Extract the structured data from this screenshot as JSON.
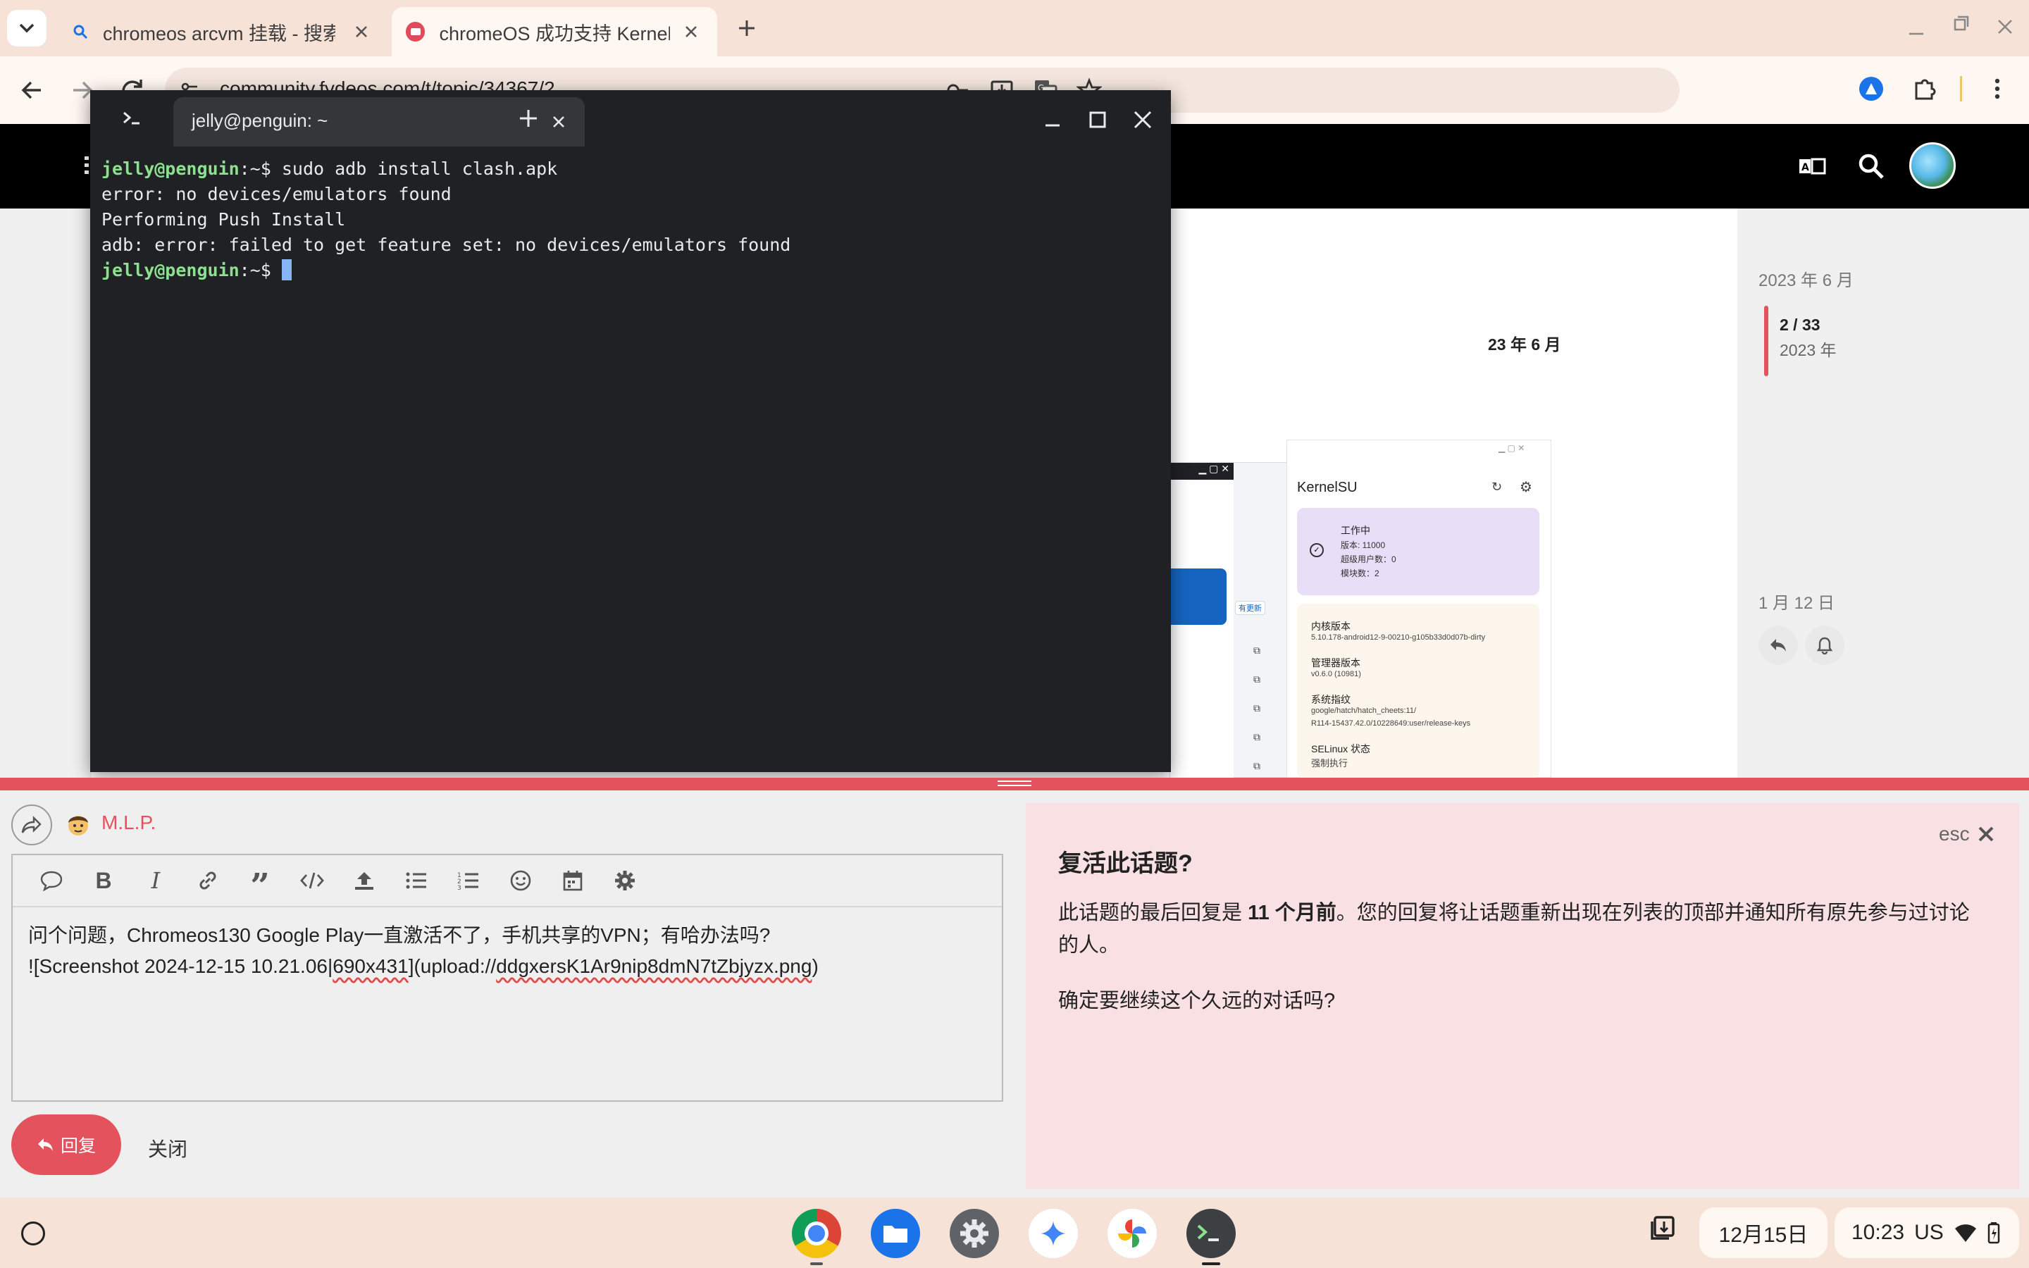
{
  "browser": {
    "tabs": [
      {
        "title": "chromeos arcvm 挂载 - 搜索",
        "active": false
      },
      {
        "title": "chromeOS 成功支持 KernelSU",
        "active": true
      }
    ],
    "url": "community.fydeos.com/t/topic/34367/2"
  },
  "terminal": {
    "tab_title": "jelly@penguin: ~",
    "lines": [
      {
        "user": "jelly@penguin",
        "path": ":~$",
        "cmd": " sudo adb install clash.apk"
      },
      {
        "text": "error: no devices/emulators found"
      },
      {
        "text": "Performing Push Install"
      },
      {
        "text": "adb: error: failed to get feature set: no devices/emulators found"
      },
      {
        "user": "jelly@penguin",
        "path": ":~$",
        "cmd": " "
      }
    ]
  },
  "post": {
    "date_label": "23 年 6 月",
    "kernelsu": {
      "app_name": "KernelSU",
      "status": "工作中",
      "version": "版本: 11000",
      "superusers": "超级用户数：0",
      "modules": "模块数：2",
      "kernel_label": "内核版本",
      "kernel_value": "5.10.178-android12-9-00210-g105b33d0d07b-dirty",
      "manager_label": "管理器版本",
      "manager_value": "v0.6.0 (10981)",
      "fingerprint_label": "系统指纹",
      "fingerprint_value_1": "google/hatch/hatch_cheets:11/",
      "fingerprint_value_2": "R114-15437.42.0/10228649:user/release-keys",
      "selinux_label": "SELinux 状态",
      "selinux_value": "强制执行",
      "update_badge": "有更新"
    }
  },
  "timeline": {
    "start": "2023 年 6 月",
    "position": "2 / 33",
    "position_date": "2023 年",
    "end": "1 月 12 日"
  },
  "composer": {
    "username": "M.L.P.",
    "text_line_1": "问个问题，Chromeos130 Google Play一直激活不了，手机共享的VPN；有哈办法吗?",
    "text_line_2_pre": "![Screenshot 2024-12-15 10.21.06|",
    "text_line_2_sq1": "690x431",
    "text_line_2_mid": "](upload://",
    "text_line_2_sq2": "ddgxersK1Ar9nip8dmN7tZbjyzx.png",
    "text_line_2_post": ")",
    "reply_label": "回复",
    "close_label": "关闭"
  },
  "dialog": {
    "title": "复活此话题?",
    "esc_label": "esc",
    "body_pre": "此话题的最后回复是 ",
    "body_bold": "11 个月前",
    "body_post": "。您的回复将让话题重新出现在列表的顶部并通知所有原先参与过讨论的人。",
    "question": "确定要继续这个久远的对话吗?"
  },
  "shelf": {
    "date": "12月15日",
    "time": "10:23",
    "ime": "US"
  }
}
